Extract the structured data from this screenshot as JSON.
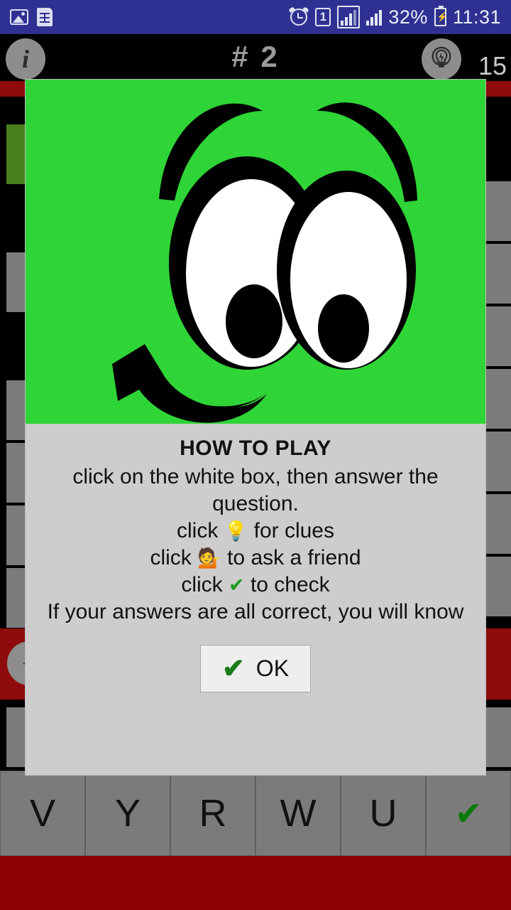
{
  "status_bar": {
    "background_color": "#2e3192",
    "left_icons": [
      {
        "name": "photo-icon",
        "label": "photo"
      },
      {
        "name": "sim-card-icon",
        "label": "sim card"
      }
    ],
    "right_icons": [
      {
        "name": "alarm-icon",
        "label": "alarm"
      },
      {
        "name": "sim-slot-icon",
        "label": "1"
      }
    ],
    "sim_badge": "1",
    "battery_percent": "32%",
    "time": "11:31"
  },
  "game_header": {
    "info_icon": "i",
    "info_icon_name": "info-icon",
    "puzzle_number": "# 2",
    "bulb_icon_name": "lightbulb-icon",
    "clue_count": "15"
  },
  "board": {
    "keyboard_keys": [
      "V",
      "Y",
      "R",
      "W",
      "U",
      "✔"
    ],
    "circle_button_glyph": "◄",
    "cell_color": "#7b7b7b",
    "filled_cell_color": "#4a7f1e",
    "red_bar_color": "#8e0b0b"
  },
  "dialog": {
    "image_alt": "green cartoon smiling face",
    "image_background": "#2fd437",
    "title": "HOW TO PLAY",
    "lines": [
      "click on the white box, then answer the",
      "question.",
      "click 💡 for clues",
      "click 💁 to ask a friend",
      "click ✔ to check",
      "If your answers are all correct, you will",
      "know"
    ],
    "line1": "click on the white box, then answer the question.",
    "line2_pre": "click ",
    "line2_post": " for clues",
    "line3_pre": "click ",
    "line3_post": " to ask a friend",
    "line4_pre": "click ",
    "line4_post": " to check",
    "line5": "If your answers are all correct, you will know",
    "ok_label": "OK",
    "ok_check": "✔",
    "background_color": "#cdcdcd"
  }
}
